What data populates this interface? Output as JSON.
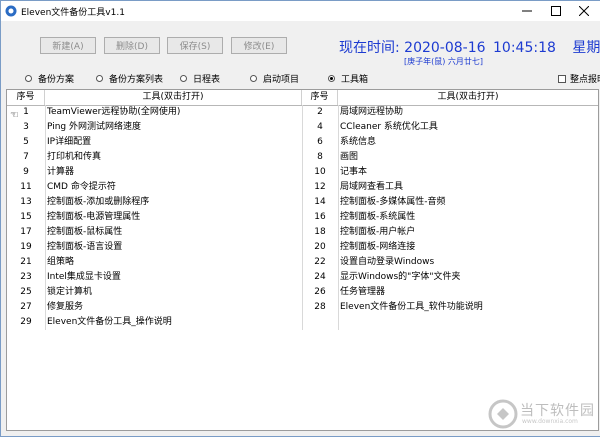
{
  "window": {
    "title": "Eleven文件备份工具v1.1"
  },
  "toolbar": {
    "new_label": "新建(A)",
    "delete_label": "删除(D)",
    "save_label": "保存(S)",
    "edit_label": "修改(E)"
  },
  "clock": {
    "prefix": "现在时间:",
    "date": "2020-08-16",
    "time": "10:45:18",
    "weekday": "星期日",
    "lunar": "[庚子年(鼠) 六月廿七]"
  },
  "tabs": [
    {
      "label": "备份方案",
      "selected": false
    },
    {
      "label": "备份方案列表",
      "selected": false
    },
    {
      "label": "日程表",
      "selected": false
    },
    {
      "label": "启动项目",
      "selected": false
    },
    {
      "label": "工具箱",
      "selected": true
    }
  ],
  "checkbox_label": "整点报时",
  "table": {
    "headers": [
      "序号",
      "工具(双击打开)",
      "序号",
      "工具(双击打开)"
    ],
    "rows": [
      [
        "1",
        "TeamViewer远程协助(全网使用)",
        "2",
        "局域网远程协助"
      ],
      [
        "3",
        "Ping 外网测试网络速度",
        "4",
        "CCleaner 系统优化工具"
      ],
      [
        "5",
        "IP详细配置",
        "6",
        "系统信息"
      ],
      [
        "7",
        "打印机和传真",
        "8",
        "画图"
      ],
      [
        "9",
        "计算器",
        "10",
        "记事本"
      ],
      [
        "11",
        "CMD 命令提示符",
        "12",
        "局域网查看工具"
      ],
      [
        "13",
        "控制面板-添加或删除程序",
        "14",
        "控制面板-多媒体属性-音频"
      ],
      [
        "15",
        "控制面板-电源管理属性",
        "16",
        "控制面板-系统属性"
      ],
      [
        "17",
        "控制面板-鼠标属性",
        "18",
        "控制面板-用户帐户"
      ],
      [
        "19",
        "控制面板-语言设置",
        "20",
        "控制面板-网络连接"
      ],
      [
        "21",
        "组策略",
        "22",
        "设置自动登录Windows"
      ],
      [
        "23",
        "Intel集成显卡设置",
        "24",
        "显示Windows的\"字体\"文件夹"
      ],
      [
        "25",
        "锁定计算机",
        "26",
        "任务管理器"
      ],
      [
        "27",
        "修复服务",
        "28",
        "Eleven文件备份工具_软件功能说明"
      ],
      [
        "29",
        "Eleven文件备份工具_操作说明",
        "",
        ""
      ]
    ]
  },
  "watermark": {
    "text": "当下软件园",
    "sub": "www.downxia.com"
  }
}
